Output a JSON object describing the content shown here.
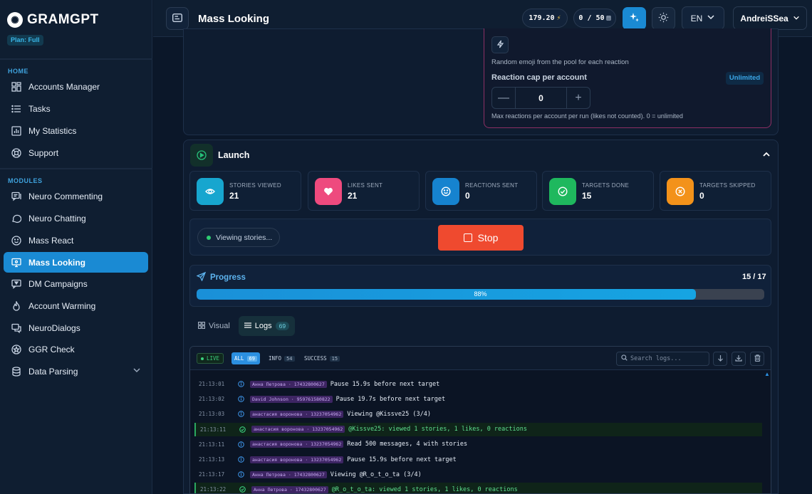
{
  "brand": {
    "name": "GRAMGPT",
    "plan": "Plan: Full"
  },
  "sidebar": {
    "home_label": "HOME",
    "home_items": [
      {
        "label": "Accounts Manager",
        "icon": "grid-icon"
      },
      {
        "label": "Tasks",
        "icon": "list-icon"
      },
      {
        "label": "My Statistics",
        "icon": "chart-icon"
      },
      {
        "label": "Support",
        "icon": "lifebuoy-icon"
      }
    ],
    "modules_label": "MODULES",
    "module_items": [
      {
        "label": "Neuro Commenting",
        "icon": "comments-icon"
      },
      {
        "label": "Neuro Chatting",
        "icon": "chat-bubble-icon"
      },
      {
        "label": "Mass React",
        "icon": "smile-icon"
      },
      {
        "label": "Mass Looking",
        "icon": "monitor-eye-icon",
        "active": true
      },
      {
        "label": "DM Campaigns",
        "icon": "dm-icon"
      },
      {
        "label": "Account Warming",
        "icon": "flame-icon"
      },
      {
        "label": "NeuroDialogs",
        "icon": "dialogs-icon"
      },
      {
        "label": "GGR Check",
        "icon": "star-badge-icon"
      },
      {
        "label": "Data Parsing",
        "icon": "database-icon"
      }
    ]
  },
  "topbar": {
    "title": "Mass Looking",
    "balance": "179.20",
    "usage": "0 / 50",
    "language": "EN",
    "user": "AndreiSSea"
  },
  "reaction_settings": {
    "random_emoji_text": "Random emoji from the pool for each reaction",
    "cap_label": "Reaction cap per account",
    "cap_badge": "Unlimited",
    "cap_value": "0",
    "cap_hint": "Max reactions per account per run (likes not counted). 0 = unlimited"
  },
  "launch": {
    "title": "Launch",
    "stats": [
      {
        "label": "STORIES VIEWED",
        "value": "21",
        "color": "#17a6cf",
        "icon": "eye-icon"
      },
      {
        "label": "LIKES SENT",
        "value": "21",
        "color": "#ee4a7e",
        "icon": "heart-icon"
      },
      {
        "label": "REACTIONS SENT",
        "value": "0",
        "color": "#1683cf",
        "icon": "smile-icon"
      },
      {
        "label": "TARGETS DONE",
        "value": "15",
        "color": "#1fb85e",
        "icon": "check-circle-icon"
      },
      {
        "label": "TARGETS SKIPPED",
        "value": "0",
        "color": "#f3921a",
        "icon": "x-circle-icon"
      }
    ],
    "status": "Viewing stories...",
    "stop_label": "Stop"
  },
  "progress": {
    "title": "Progress",
    "count": "15 / 17",
    "percent_label": "88%",
    "fraction": 0.88
  },
  "tabs": {
    "visual_label": "Visual",
    "logs_label": "Logs",
    "logs_count": "69"
  },
  "logs": {
    "live_label": "LIVE",
    "filters": [
      {
        "label": "ALL",
        "count": "69",
        "active": true
      },
      {
        "label": "INFO",
        "count": "54"
      },
      {
        "label": "SUCCESS",
        "count": "15"
      }
    ],
    "search_placeholder": "Search logs...",
    "rows": [
      {
        "time": "21:13:01",
        "type": "info",
        "account": "Анна Петрова · 17432800627",
        "message": "Pause 15.9s before next target"
      },
      {
        "time": "21:13:02",
        "type": "info",
        "account": "David Johnson · 959761580822",
        "message": "Pause 19.7s before next target"
      },
      {
        "time": "21:13:03",
        "type": "info",
        "account": "анастасия воронова · 13237054962",
        "message": "Viewing @Kissve25 (3/4)"
      },
      {
        "time": "21:13:11",
        "type": "success",
        "account": "анастасия воронова · 13237054962",
        "message": "@Kissve25: viewed 1 stories, 1 likes, 0 reactions"
      },
      {
        "time": "21:13:11",
        "type": "info",
        "account": "анастасия воронова · 13237054962",
        "message": "Read 500 messages, 4 with stories"
      },
      {
        "time": "21:13:13",
        "type": "info",
        "account": "анастасия воронова · 13237054962",
        "message": "Pause 15.9s before next target"
      },
      {
        "time": "21:13:17",
        "type": "info",
        "account": "Анна Петрова · 17432800627",
        "message": "Viewing @R_o_t_o_ta (3/4)"
      },
      {
        "time": "21:13:22",
        "type": "success",
        "account": "Анна Петрова · 17432800627",
        "message": "@R_o_t_o_ta: viewed 1 stories, 1 likes, 0 reactions"
      }
    ]
  },
  "colors": {
    "accent": "#1a8ad3",
    "stop": "#ef4a2f",
    "success": "#2ecc71",
    "reaction_border": "#8c2f64"
  }
}
